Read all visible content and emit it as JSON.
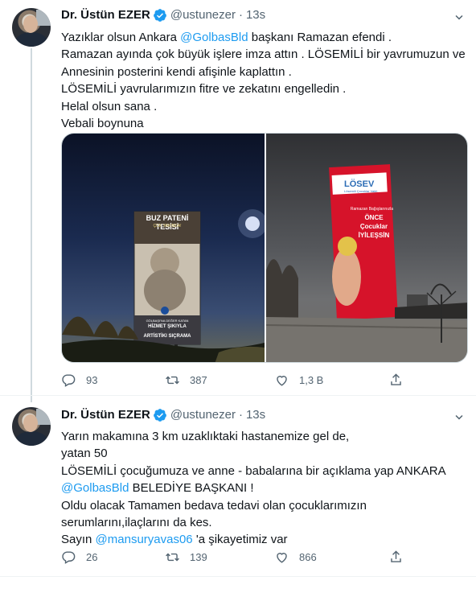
{
  "tweets": [
    {
      "author": {
        "name": "Dr. Üstün EZER",
        "handle": "@ustunezer",
        "time": "13s"
      },
      "lines": [
        {
          "pre": "Yazıklar olsun Ankara ",
          "mention": "@GolbasBld",
          "post": " başkanı Ramazan efendi ."
        },
        {
          "pre": "Ramazan ayında çok büyük işlere imza attın . LÖSEMİLİ bir yavrumuzun ve",
          "mention": "",
          "post": ""
        },
        {
          "pre": "Annesinin posterini kendi afişinle kaplattın .",
          "mention": "",
          "post": ""
        },
        {
          "pre": "LÖSEMİLİ yavrularımızın fitre ve zekatını engelledin .",
          "mention": "",
          "post": ""
        },
        {
          "pre": "Helal olsun sana .",
          "mention": "",
          "post": ""
        },
        {
          "pre": "Vebali boynuna",
          "mention": "",
          "post": ""
        }
      ],
      "media": {
        "left": {
          "title": "BUZ PATENİ TESİSİ",
          "subtitle": "ÇOK YAKINDA!",
          "caption1": "GÖLBAŞI'NI GELECEKLE İNŞA EDEN HİZMET",
          "caption2": "HİZMET",
          "caption3": "ARTİSTİK BUZ PATENİ",
          "caption_small": "GÖLBAŞI'NA DEĞER KATAN",
          "mid_tail": "ŞIKIYLA",
          "bottom_tail": "I SIÇRAMA"
        },
        "right": {
          "logo": "LÖSEV",
          "logo_sub": "Lösemili Çocuklar Vakfı",
          "line1": "Ramazan Bağışlarınızla",
          "line2": "ÖNCE",
          "line3": "Çocuklar",
          "line4": "İYİLEŞSİN"
        }
      },
      "stats": {
        "replies": "93",
        "retweets": "387",
        "likes": "1,3 B"
      }
    },
    {
      "author": {
        "name": "Dr. Üstün EZER",
        "handle": "@ustunezer",
        "time": "13s"
      },
      "lines": [
        {
          "pre": "Yarın makamına 3 km uzaklıktaki hastanemize gel de,",
          "mention": "",
          "post": ""
        },
        {
          "pre": "yatan 50",
          "mention": "",
          "post": ""
        },
        {
          "pre": "LÖSEMİLİ çocuğumuza ve anne - babalarına bir açıklama yap ANKARA",
          "mention": "",
          "post": ""
        },
        {
          "pre": "",
          "mention": "@GolbasBld",
          "post": " BELEDİYE BAŞKANI !"
        },
        {
          "pre": "Oldu olacak Tamamen bedava tedavi olan çocuklarımızın",
          "mention": "",
          "post": ""
        },
        {
          "pre": "serumlarını,ilaçlarını da kes.",
          "mention": "",
          "post": ""
        },
        {
          "pre": "Sayın ",
          "mention": "@mansuryavas06",
          "post": " 'a şikayetimiz var"
        }
      ],
      "stats": {
        "replies": "26",
        "retweets": "139",
        "likes": "866"
      }
    }
  ],
  "colors": {
    "accent": "#1d9bf0",
    "text": "#0f1419",
    "muted": "#536471",
    "border": "#cfd9de",
    "losev_red": "#d6132a"
  },
  "icons": [
    "verified-badge-icon",
    "more-options-icon",
    "reply-icon",
    "retweet-icon",
    "like-icon",
    "share-icon"
  ]
}
